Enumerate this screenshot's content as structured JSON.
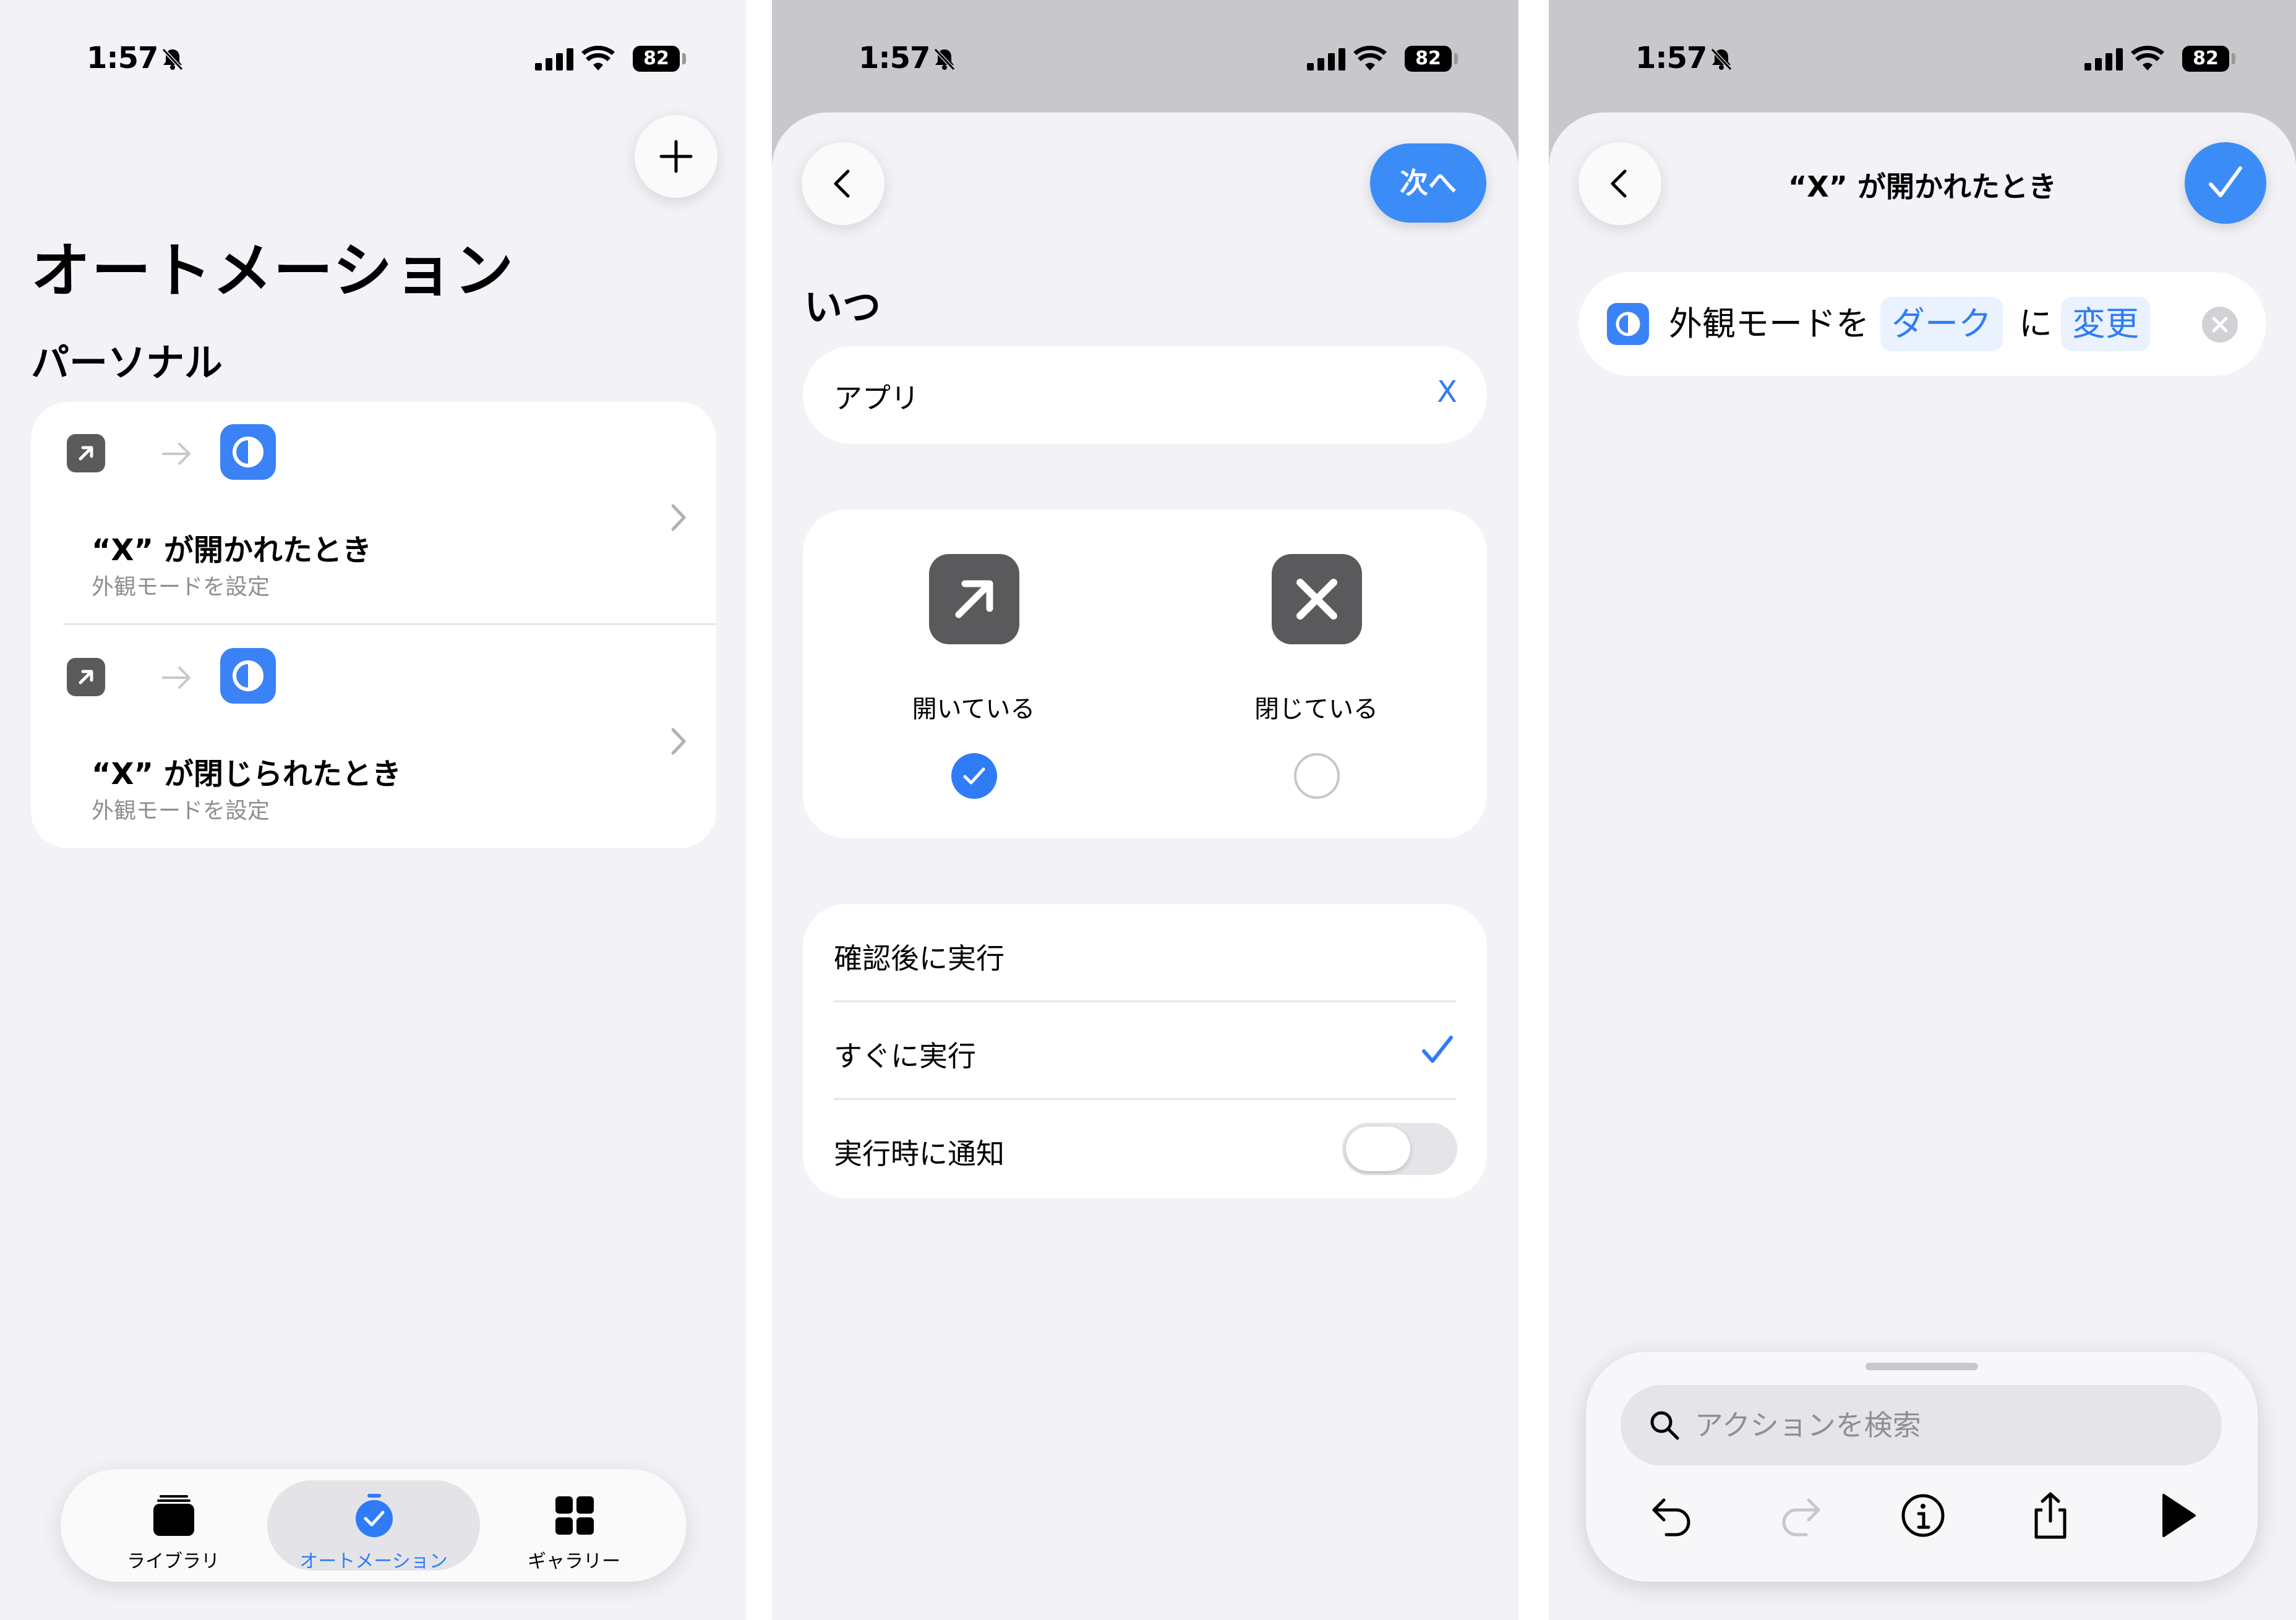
{
  "status": {
    "time": "1:57",
    "battery": "82"
  },
  "screen1": {
    "title": "オートメーション",
    "section": "パーソナル",
    "automations": [
      {
        "title": "“X” が開かれたとき",
        "subtitle": "外観モードを設定"
      },
      {
        "title": "“X” が閉じられたとき",
        "subtitle": "外観モードを設定"
      }
    ],
    "tabs": [
      {
        "label": "ライブラリ"
      },
      {
        "label": "オートメーション"
      },
      {
        "label": "ギャラリー"
      }
    ]
  },
  "screen2": {
    "next_label": "次へ",
    "when_title": "いつ",
    "app_label": "アプリ",
    "app_value": "X",
    "states": [
      {
        "label": "開いている",
        "selected": true
      },
      {
        "label": "閉じている",
        "selected": false
      }
    ],
    "run_options": [
      {
        "label": "確認後に実行"
      },
      {
        "label": "すぐに実行"
      },
      {
        "label": "実行時に通知"
      }
    ]
  },
  "screen3": {
    "title": "“X” が開かれたとき",
    "action": {
      "prefix": "外観モードを",
      "token1": "ダーク",
      "middle": "に",
      "token2": "変更"
    },
    "search_placeholder": "アクションを検索"
  },
  "colors": {
    "accent": "#2f7cf6",
    "button_blue": "#3b8cf7",
    "background": "#f2f2f7",
    "app_icon_gray": "#5a5a5c"
  }
}
